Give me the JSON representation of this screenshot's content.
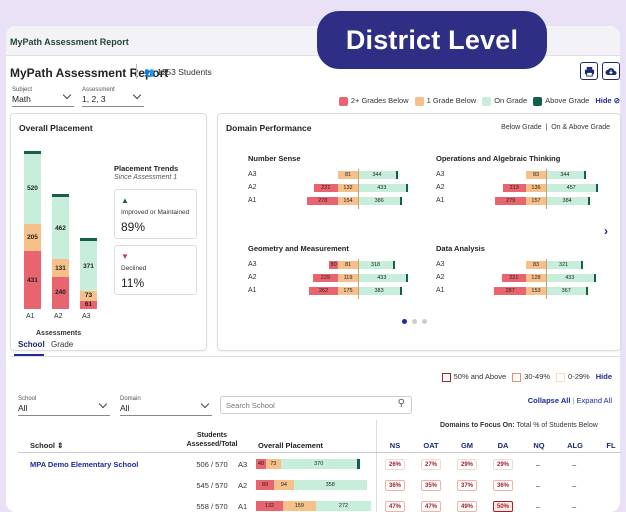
{
  "app": {
    "title": "MyPath Assessment Report"
  },
  "banner": {
    "label": "District Level"
  },
  "header": {
    "title": "MyPath Assessment Report",
    "students": "1253 Students"
  },
  "filters": {
    "subject": {
      "label": "Subject",
      "value": "Math"
    },
    "assessment": {
      "label": "Assessment",
      "value": "1, 2, 3"
    }
  },
  "legend": {
    "items": [
      {
        "label": "2+ Grades Below",
        "color": "#e8646e"
      },
      {
        "label": "1 Grade Below",
        "color": "#f6c08a"
      },
      {
        "label": "On Grade",
        "color": "#c7eedb"
      },
      {
        "label": "Above Grade",
        "color": "#145f4a"
      }
    ],
    "hide": "Hide"
  },
  "overall": {
    "title": "Overall Placement",
    "xaxis": "Assessments",
    "bars": [
      {
        "label": "A1",
        "below2": 431,
        "below1": 205,
        "on": 520,
        "above": 4
      },
      {
        "label": "A2",
        "below2": 240,
        "below1": 131,
        "on": 462,
        "above": 4
      },
      {
        "label": "A3",
        "below2": 61,
        "below1": 73,
        "on": 371,
        "above": 4
      }
    ],
    "trends": {
      "title": "Placement Trends",
      "since": "Since Assessment 1",
      "improved_label": "Improved or Maintained",
      "improved_value": "89%",
      "declined_label": "Declined",
      "declined_value": "11%"
    }
  },
  "domain": {
    "title": "Domain Performance",
    "toggle_below": "Below Grade",
    "toggle_sep": "|",
    "toggle_on": "On & Above Grade",
    "blocks": [
      {
        "title": "Number Sense",
        "rows": [
          {
            "label": "A3",
            "b2": null,
            "b1": 81,
            "on": 344
          },
          {
            "label": "A2",
            "b2": 221,
            "b1": 132,
            "on": 433
          },
          {
            "label": "A1",
            "b2": 278,
            "b1": 154,
            "on": 386
          }
        ]
      },
      {
        "title": "Operations and Algebraic Thinking",
        "rows": [
          {
            "label": "A3",
            "b2": null,
            "b1": 83,
            "on": 344
          },
          {
            "label": "A2",
            "b2": 213,
            "b1": 136,
            "on": 457
          },
          {
            "label": "A1",
            "b2": 279,
            "b1": 157,
            "on": 384
          }
        ]
      },
      {
        "title": "Geometry and Measurement",
        "rows": [
          {
            "label": "A3",
            "b2": 80,
            "b1": 81,
            "on": 318
          },
          {
            "label": "A2",
            "b2": 229,
            "b1": 119,
            "on": 433
          },
          {
            "label": "A1",
            "b2": 262,
            "b1": 175,
            "on": 383
          }
        ]
      },
      {
        "title": "Data Analysis",
        "rows": [
          {
            "label": "A3",
            "b2": null,
            "b1": 83,
            "on": 321
          },
          {
            "label": "A2",
            "b2": 221,
            "b1": 128,
            "on": 433
          },
          {
            "label": "A1",
            "b2": 287,
            "b1": 153,
            "on": 367
          }
        ]
      }
    ]
  },
  "tabs": {
    "school": "School",
    "grade": "Grade"
  },
  "pct_legend": {
    "high": "50% and Above",
    "mid": "30-49%",
    "low": "0-29%",
    "hide": "Hide"
  },
  "table_filters": {
    "school": {
      "label": "School",
      "value": "All"
    },
    "domain": {
      "label": "Domain",
      "value": "All"
    },
    "search_placeholder": "Search School",
    "collapse": "Collapse All",
    "sep": "|",
    "expand": "Expand All"
  },
  "table": {
    "focus_label_bold": "Domains to Focus On:",
    "focus_label": " Total % of Students Below",
    "col_school": "School",
    "col_students_1": "Students",
    "col_students_2": "Assessed/Total",
    "col_overall": "Overall Placement",
    "domain_cols": [
      "NS",
      "OAT",
      "GM",
      "DA",
      "NQ",
      "ALG",
      "FL"
    ],
    "school_name": "MPA Demo Elementary School",
    "rows": [
      {
        "students": "506 / 570",
        "a": "A3",
        "b2": 48,
        "b1": 73,
        "on": 370,
        "pcts": [
          "26%",
          "27%",
          "29%",
          "29%",
          "–",
          "–"
        ]
      },
      {
        "students": "545 / 570",
        "a": "A2",
        "b2": 89,
        "b1": 94,
        "on": 358,
        "pcts": [
          "36%",
          "35%",
          "37%",
          "36%",
          "–",
          "–"
        ]
      },
      {
        "students": "558 / 570",
        "a": "A1",
        "b2": 132,
        "b1": 159,
        "on": 272,
        "pcts": [
          "47%",
          "47%",
          "49%",
          "50%",
          "–",
          "–"
        ]
      }
    ]
  }
}
